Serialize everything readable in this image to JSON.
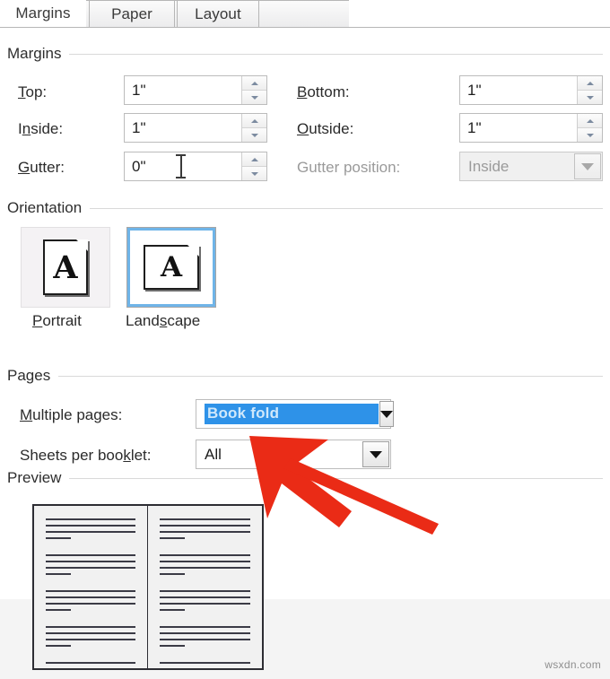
{
  "dialog": {
    "tabs": [
      {
        "label": "Margins",
        "active": true
      },
      {
        "label": "Paper",
        "active": false
      },
      {
        "label": "Layout",
        "active": false
      }
    ]
  },
  "margins_group": {
    "header": "Margins",
    "fields": [
      {
        "label_pre": "T",
        "label_key": "o",
        "label_post": "p:",
        "label": "Top:",
        "value": "1\""
      },
      {
        "label_pre": "I",
        "label_key": "n",
        "label_post": "side:",
        "label": "Inside:",
        "value": "1\""
      },
      {
        "label_pre": "",
        "label_key": "G",
        "label_post": "utter:",
        "label": "Gutter:",
        "value": "0\""
      },
      {
        "label_pre": "",
        "label_key": "B",
        "label_post": "ottom:",
        "label": "Bottom:",
        "value": "1\""
      },
      {
        "label_pre": "",
        "label_key": "O",
        "label_post": "utside:",
        "label": "Outside:",
        "value": "1\""
      }
    ],
    "gutter_position": {
      "label": "Gutter position:",
      "value": "Inside",
      "disabled": true
    }
  },
  "orientation_group": {
    "header": "Orientation",
    "options": [
      {
        "label_pre": "",
        "label_key": "P",
        "label_post": "ortrait",
        "label": "Portrait",
        "glyph": "A",
        "selected": false
      },
      {
        "label_pre": "Land",
        "label_key": "s",
        "label_post": "cape",
        "label": "Landscape",
        "glyph": "A",
        "selected": true
      }
    ]
  },
  "pages_group": {
    "header": "Pages",
    "multiple_pages": {
      "label_pre": "M",
      "label_key": "u",
      "label_post": "ltiple pages:",
      "label": "Multiple pages:",
      "value": "Book fold",
      "selected_highlight": true
    },
    "sheets_per_booklet": {
      "label_pre": "Sheets per boo",
      "label_key": "k",
      "label_post": "let:",
      "label": "Sheets per booklet:",
      "value": "All"
    }
  },
  "preview_group": {
    "header": "Preview"
  },
  "annotation": {
    "type": "arrow",
    "color": "#ea2b16",
    "points_at": "Sheets per booklet dropdown"
  },
  "watermark": {
    "text": "wsxdn.com"
  },
  "colors": {
    "selection_blue": "#2e92e8",
    "selected_outline": "#6fb4e8",
    "arrow_red": "#ea2b16",
    "disabled_text": "#9a9a9a"
  }
}
